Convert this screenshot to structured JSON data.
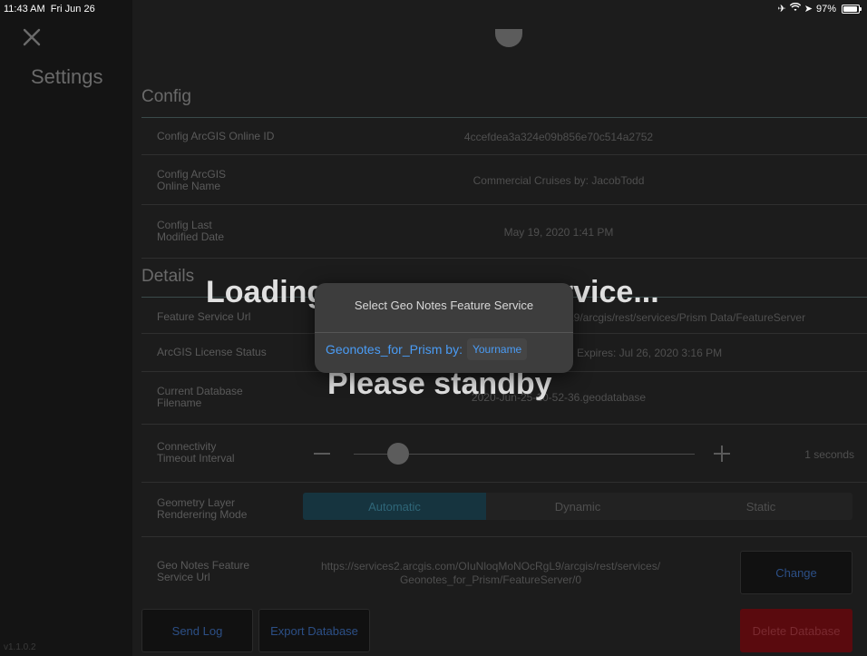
{
  "status_bar": {
    "time": "11:43 AM",
    "date": "Fri Jun 26",
    "battery": "97%"
  },
  "sidebar": {
    "title": "Settings",
    "version": "v1.1.0.2"
  },
  "config": {
    "section_title": "Config",
    "rows": [
      {
        "label": "Config ArcGIS Online ID",
        "value": "4ccefdea3a324e09b856e70c514a2752"
      },
      {
        "label": "Config ArcGIS\nOnline Name",
        "value": "Commercial Cruises by: JacobTodd"
      },
      {
        "label": "Config Last\nModified Date",
        "value": "May 19, 2020 1:41 PM"
      }
    ]
  },
  "details": {
    "section_title": "Details",
    "feature_service_url": {
      "label": "Feature Service Url",
      "value": "L9/arcgis/rest/services/Prism Data/FeatureServer"
    },
    "license_status": {
      "label": "ArcGIS License Status",
      "value": "Expires: Jul 26, 2020 3:16 PM"
    },
    "database_filename": {
      "label": "Current Database\nFilename",
      "value": "2020-Jun-25-10-52-36.geodatabase"
    },
    "connectivity": {
      "label": "Connectivity\nTimeout Interval",
      "value": "1 seconds",
      "slider_fraction": 0.13
    },
    "geometry_mode": {
      "label": "Geometry Layer\nRenderering Mode",
      "options": [
        "Automatic",
        "Dynamic",
        "Static"
      ],
      "selected": "Automatic"
    },
    "geo_notes_url": {
      "label": "Geo Notes Feature\nService Url",
      "value": "https://services2.arcgis.com/OIuNloqMoNOcRgL9/arcgis/rest/services/\nGeonotes_for_Prism/FeatureServer/0",
      "change_label": "Change"
    }
  },
  "actions": {
    "send_log": "Send Log",
    "export_database": "Export Database",
    "delete_database": "Delete Database"
  },
  "overlay": {
    "loading_part1": "Loading",
    "loading_part2": "ervice...",
    "standby": "Please standby"
  },
  "popover": {
    "title": "Select Geo Notes Feature Service",
    "item_name": "Geonotes_for_Prism by:",
    "item_user": "Yourname"
  }
}
